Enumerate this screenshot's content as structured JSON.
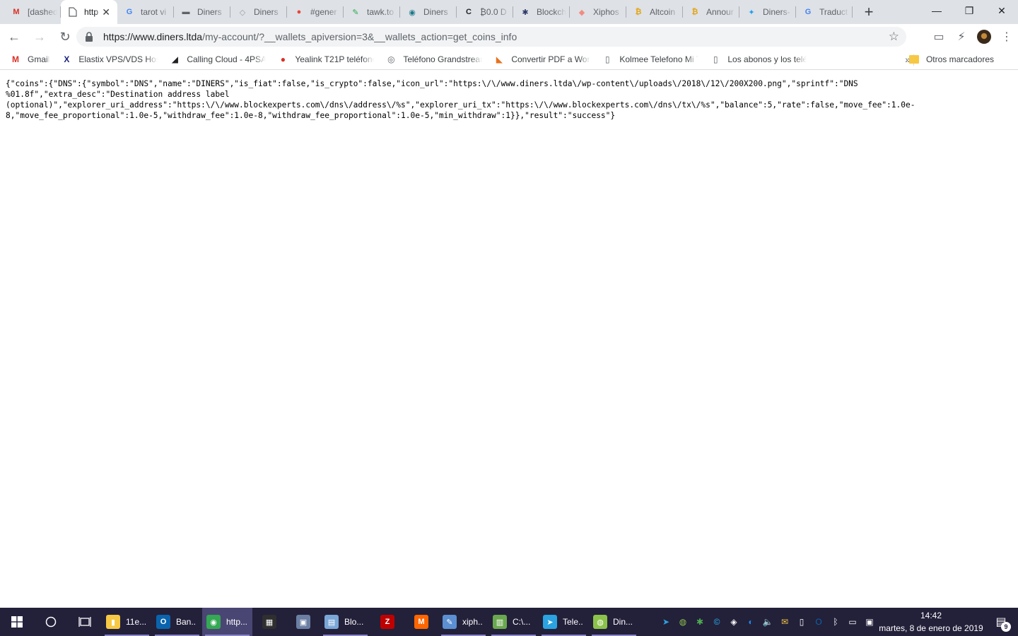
{
  "browser": {
    "tabs": [
      {
        "title": "[dashed",
        "icon": "gmail-icon",
        "color": "#d93025",
        "glyph": "M",
        "active": false
      },
      {
        "title": "http",
        "icon": "page-icon",
        "color": "#5f6368",
        "glyph": "",
        "active": true
      },
      {
        "title": "tarot vi",
        "icon": "google-icon",
        "color": "#4285f4",
        "glyph": "G",
        "active": false
      },
      {
        "title": "Diners",
        "icon": "wallet-icon",
        "color": "#5f6368",
        "glyph": "▬",
        "active": false
      },
      {
        "title": "Diners",
        "icon": "cube-icon",
        "color": "#9aa0a6",
        "glyph": "◇",
        "active": false
      },
      {
        "title": "#gener",
        "icon": "chat-icon",
        "color": "#e8453c",
        "glyph": "●",
        "active": false
      },
      {
        "title": "tawk.to",
        "icon": "tawk-icon",
        "color": "#2da94f",
        "glyph": "✎",
        "active": false
      },
      {
        "title": "Diners",
        "icon": "blockexperts-icon",
        "color": "#1b7a8a",
        "glyph": "◉",
        "active": false
      },
      {
        "title": "₿0.0 D",
        "icon": "crex-icon",
        "color": "#202124",
        "glyph": "C",
        "active": false
      },
      {
        "title": "Blockch",
        "icon": "blockchain-icon",
        "color": "#2b3a67",
        "glyph": "✱",
        "active": false
      },
      {
        "title": "Xiphos",
        "icon": "xiphos-icon",
        "color": "#f28b82",
        "glyph": "◆",
        "active": false
      },
      {
        "title": "Altcoin",
        "icon": "coin-icon",
        "color": "#e2a516",
        "glyph": "₿",
        "active": false
      },
      {
        "title": "Annour",
        "icon": "coin-icon",
        "color": "#e2a516",
        "glyph": "₿",
        "active": false
      },
      {
        "title": "Diners-",
        "icon": "twitter-icon",
        "color": "#1da1f2",
        "glyph": "✦",
        "active": false
      },
      {
        "title": "Traduct",
        "icon": "translate-icon",
        "color": "#4285f4",
        "glyph": "G",
        "active": false
      }
    ],
    "close_glyph": "✕",
    "new_tab_glyph": "+",
    "window_controls": {
      "minimize": "—",
      "maximize": "❐",
      "close": "✕"
    },
    "toolbar": {
      "back": "←",
      "forward": "→",
      "reload": "↻",
      "url_host": "https://www.diners.ltda",
      "url_path": "/my-account/?__wallets_apiversion=3&__wallets_action=get_coins_info",
      "bookmark_star": "☆",
      "cast": "▭",
      "extension": "⚡",
      "menu": "⋮"
    },
    "bookmarks": [
      {
        "label": "Gmail",
        "icon": "gmail-icon",
        "glyph": "M",
        "color": "#d93025"
      },
      {
        "label": "Elastix VPS/VDS Host",
        "icon": "elastix-icon",
        "glyph": "X",
        "color": "#1a237e"
      },
      {
        "label": "Calling Cloud - 4PSA",
        "icon": "4psa-icon",
        "glyph": "◢",
        "color": "#202124"
      },
      {
        "label": "Yealink T21P teléfono",
        "icon": "yealink-icon",
        "glyph": "●",
        "color": "#d93025"
      },
      {
        "label": "Teléfono Grandstream",
        "icon": "grandstream-icon",
        "glyph": "◎",
        "color": "#5f6368"
      },
      {
        "label": "Convertir PDF a Word",
        "icon": "pdf-icon",
        "glyph": "◣",
        "color": "#e8711c"
      },
      {
        "label": "Kolmee Telefono Mi T",
        "icon": "page-icon",
        "glyph": "▯",
        "color": "#5f6368"
      },
      {
        "label": "Los abonos y los telé",
        "icon": "page-icon",
        "glyph": "▯",
        "color": "#5f6368"
      }
    ],
    "bookmarks_overflow": "»",
    "other_bookmarks": "Otros marcadores"
  },
  "page": {
    "json_text": "{\"coins\":{\"DNS\":{\"symbol\":\"DNS\",\"name\":\"DINERS\",\"is_fiat\":false,\"is_crypto\":false,\"icon_url\":\"https:\\/\\/www.diners.ltda\\/wp-content\\/uploads\\/2018\\/12\\/200X200.png\",\"sprintf\":\"DNS\n%01.8f\",\"extra_desc\":\"Destination address label\n(optional)\",\"explorer_uri_address\":\"https:\\/\\/www.blockexperts.com\\/dns\\/address\\/%s\",\"explorer_uri_tx\":\"https:\\/\\/www.blockexperts.com\\/dns\\/tx\\/%s\",\"balance\":5,\"rate\":false,\"move_fee\":1.0e-\n8,\"move_fee_proportional\":1.0e-5,\"withdraw_fee\":1.0e-8,\"withdraw_fee_proportional\":1.0e-5,\"min_withdraw\":1}},\"result\":\"success\"}"
  },
  "taskbar": {
    "start_glyph": "⊞",
    "search_glyph": "○",
    "taskview_glyph": "⧉",
    "apps": [
      {
        "label": "11e...",
        "icon": "folder-icon",
        "glyph": "▮",
        "color": "#f6c843",
        "open": true,
        "active": false
      },
      {
        "label": "Ban...",
        "icon": "outlook-icon",
        "glyph": "O",
        "color": "#0a64ad",
        "open": true,
        "active": false
      },
      {
        "label": "http...",
        "icon": "chrome-icon",
        "glyph": "◉",
        "color": "#34a853",
        "open": true,
        "active": true
      },
      {
        "label": "",
        "icon": "calculator-icon",
        "glyph": "▦",
        "color": "#2f2f2f",
        "open": false,
        "active": false
      },
      {
        "label": "",
        "icon": "network-icon",
        "glyph": "▣",
        "color": "#6b7fa3",
        "open": false,
        "active": false
      },
      {
        "label": "Blo...",
        "icon": "notepad-icon",
        "glyph": "▤",
        "color": "#7aa7d6",
        "open": true,
        "active": false
      },
      {
        "label": "",
        "icon": "filezilla-icon",
        "glyph": "Z",
        "color": "#bf0000",
        "open": false,
        "active": false
      },
      {
        "label": "",
        "icon": "monero-icon",
        "glyph": "M",
        "color": "#ff6600",
        "open": false,
        "active": false
      },
      {
        "label": "xiph...",
        "icon": "paint-icon",
        "glyph": "✎",
        "color": "#5b8fd1",
        "open": true,
        "active": false
      },
      {
        "label": "C:\\...",
        "icon": "terminal-icon",
        "glyph": "▥",
        "color": "#6aa84f",
        "open": true,
        "active": false
      },
      {
        "label": "Tele...",
        "icon": "telegram-icon",
        "glyph": "➤",
        "color": "#2aa3e0",
        "open": true,
        "active": false
      },
      {
        "label": "Din...",
        "icon": "diners-wallet-icon",
        "glyph": "◍",
        "color": "#8bc34a",
        "open": true,
        "active": false
      }
    ],
    "tray_icons": [
      {
        "icon": "telegram-tray-icon",
        "glyph": "➤",
        "color": "#2aa3e0"
      },
      {
        "icon": "diners-tray-icon",
        "glyph": "◍",
        "color": "#8bc34a"
      },
      {
        "icon": "xiphos-tray-icon",
        "glyph": "✱",
        "color": "#4caf50"
      },
      {
        "icon": "copyright-tray-icon",
        "glyph": "©",
        "color": "#29b6f6"
      },
      {
        "icon": "shield-tray-icon",
        "glyph": "◈",
        "color": "#ffffff"
      },
      {
        "icon": "defender-tray-icon",
        "glyph": "◐",
        "color": "#1e88e5"
      },
      {
        "icon": "volume-icon",
        "glyph": "🔈",
        "color": "#ffffff"
      },
      {
        "icon": "mail-tray-icon",
        "glyph": "✉",
        "color": "#f6c843"
      },
      {
        "icon": "usb-icon",
        "glyph": "▯",
        "color": "#ffffff"
      },
      {
        "icon": "outlook-tray-icon",
        "glyph": "O",
        "color": "#0a64ad"
      },
      {
        "icon": "bluetooth-icon",
        "glyph": "ᛒ",
        "color": "#ffffff"
      },
      {
        "icon": "power-icon",
        "glyph": "▭",
        "color": "#ffffff"
      },
      {
        "icon": "network-tray-icon",
        "glyph": "▣",
        "color": "#ffffff"
      }
    ],
    "time": "14:42",
    "date": "martes, 8 de enero de 2019",
    "notification_glyph": "▤",
    "notification_count": "9"
  }
}
